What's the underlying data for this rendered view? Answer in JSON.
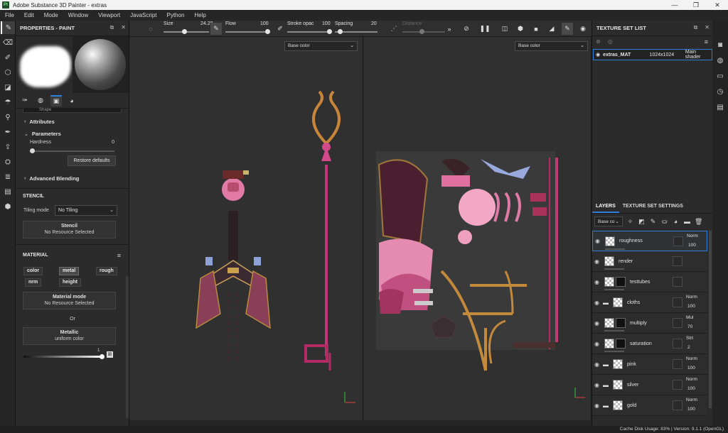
{
  "window": {
    "title": "Adobe Substance 3D Painter - extras",
    "logo": "Pt",
    "controls": [
      "—",
      "❐",
      "✕"
    ]
  },
  "menu": [
    "File",
    "Edit",
    "Mode",
    "Window",
    "Viewport",
    "JavaScript",
    "Python",
    "Help"
  ],
  "properties": {
    "title": "PROPERTIES - PAINT",
    "shape_label": "Shape",
    "attributes": "Attributes",
    "parameters": "Parameters",
    "hardness_label": "Hardness",
    "hardness_value": "0",
    "restore": "Restore defaults",
    "advanced_blending": "Advanced Blending",
    "stencil_title": "STENCIL",
    "tiling_label": "Tiling mode",
    "tiling_value": "No Tiling",
    "stencil_box_title": "Stencil",
    "stencil_box_value": "No Resource Selected",
    "material_title": "MATERIAL",
    "channels": [
      "color",
      "metal",
      "rough",
      "nrm",
      "height"
    ],
    "material_mode_title": "Material mode",
    "material_mode_value": "No Resource Selected",
    "or_label": "Or",
    "metallic_title": "Metallic",
    "metallic_value": "uniform color",
    "metallic_slider_value": "1"
  },
  "toolbar": {
    "size_label": "Size",
    "size_value": "24.28",
    "flow_label": "Flow",
    "flow_value": "100",
    "stroke_label": "Stroke opac",
    "stroke_value": "100",
    "spacing_label": "Spacing",
    "spacing_value": "20",
    "distance_label": "Distance"
  },
  "viewports": {
    "left_channel": "Base color",
    "right_channel": "Base color"
  },
  "texture_set_list": {
    "title": "TEXTURE SET LIST",
    "set": {
      "name": "extras_MAT",
      "resolution": "1024x1024",
      "shader": "Main shader"
    }
  },
  "layers_panel": {
    "tab_layers": "LAYERS",
    "tab_settings": "TEXTURE SET SETTINGS",
    "channel": "Base co",
    "layers": [
      {
        "name": "roughness",
        "blend": "Norm",
        "opacity": "100",
        "folder": false,
        "thumb": "checker"
      },
      {
        "name": "render",
        "blend": "",
        "opacity": "",
        "folder": false,
        "thumb": "checker"
      },
      {
        "name": "testtubes",
        "blend": "",
        "opacity": "",
        "folder": false,
        "thumb": "black"
      },
      {
        "name": "cloths",
        "blend": "Norm",
        "opacity": "100",
        "folder": true,
        "thumb": "checker"
      },
      {
        "name": "multiply",
        "blend": "Mul",
        "opacity": "70",
        "folder": false,
        "thumb": "black"
      },
      {
        "name": "saturation",
        "blend": "Strt",
        "opacity": "2",
        "folder": false,
        "thumb": "black"
      },
      {
        "name": "pink",
        "blend": "Norm",
        "opacity": "100",
        "folder": true,
        "thumb": "checker"
      },
      {
        "name": "silver",
        "blend": "Norm",
        "opacity": "100",
        "folder": true,
        "thumb": "checker"
      },
      {
        "name": "gold",
        "blend": "Norm",
        "opacity": "100",
        "folder": true,
        "thumb": "checker"
      }
    ]
  },
  "status": "Cache Disk Usage:   83% | Version: 9.1.1 (OpenGL)"
}
